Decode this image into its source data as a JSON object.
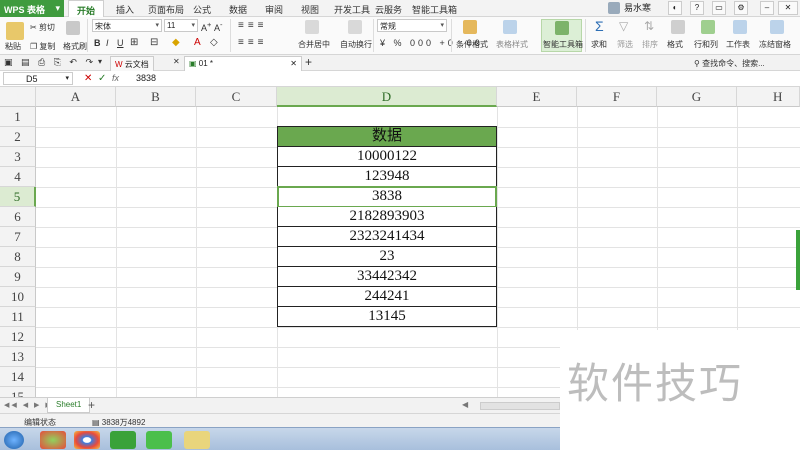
{
  "app": {
    "name": "WPS 表格",
    "user": "易水寒"
  },
  "menu": [
    "开始",
    "插入",
    "页面布局",
    "公式",
    "数据",
    "审阅",
    "视图",
    "开发工具",
    "云服务",
    "智能工具箱"
  ],
  "ribbon": {
    "cut": "剪切",
    "paste": "粘贴",
    "copy": "复制",
    "format_painter": "格式刷",
    "font_name": "宋体",
    "font_size": "11",
    "number_format": "常规",
    "merge_center": "合并居中",
    "wrap_text": "自动换行",
    "conditional_format": "条件格式",
    "table_style": "表格样式",
    "smart_toolbox": "智能工具箱",
    "sum": "求和",
    "filter": "筛选",
    "sort": "排序",
    "format": "格式",
    "row_col": "行和列",
    "worksheet": "工作表",
    "freeze": "冻结窗格",
    "search_placeholder": "查找命令、搜索..."
  },
  "tabs": {
    "cloud_docs": "云文档",
    "doc": "01 *"
  },
  "formula_bar": {
    "name_box": "D5",
    "fx": "fx",
    "value": "3838"
  },
  "columns": [
    "A",
    "B",
    "C",
    "D",
    "E",
    "F",
    "G",
    "H"
  ],
  "rows": [
    "1",
    "2",
    "3",
    "4",
    "5",
    "6",
    "7",
    "8",
    "9",
    "10",
    "11",
    "12",
    "13",
    "14",
    "15"
  ],
  "table": {
    "header": "数据",
    "values": [
      "10000122",
      "123948",
      "3838",
      "2182893903",
      "2323241434",
      "23",
      "33442342",
      "244241",
      "13145"
    ]
  },
  "sheet_tab": "Sheet1",
  "status": {
    "mode": "编辑状态",
    "info": "3838万4892"
  },
  "watermark": "软件技巧",
  "colors": {
    "accent": "#6aa84f",
    "brand": "#3f9b3e"
  }
}
